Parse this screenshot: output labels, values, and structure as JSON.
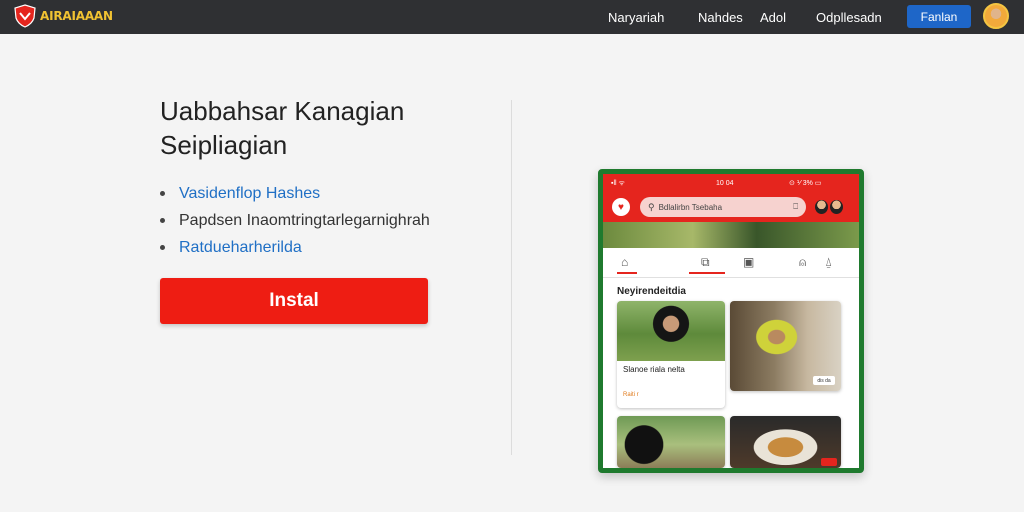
{
  "brand": {
    "name": "AIRAIAAAN",
    "accent": "#ee1d13",
    "logo_color": "#f1c232"
  },
  "nav": {
    "items": [
      "Naryariah",
      "Nahdes",
      "Adol",
      "Odpllesadn"
    ],
    "button": "Fanlan"
  },
  "hero": {
    "title_line1": "Uabbahsar Kanagian",
    "title_line2": "Seipliagian",
    "bullets": [
      "Vasidenflop Hashes",
      "Papdsen Inaomtringtarlegarnighrah",
      "Ratdueharherilda"
    ],
    "install_label": "Instal"
  },
  "phone": {
    "status_left": "▪ll ᯤ",
    "status_time": "10 04",
    "status_right": "⊙ ⅟ 3% ▭",
    "search_placeholder": "Bdlalirbn Tsebaha",
    "section_title": "Neyirendeitdia",
    "cards": [
      {
        "caption": "Slanoe riala nelta",
        "sub": "Raiti r"
      },
      {
        "chip": "dis da"
      }
    ],
    "frame_color": "#1f7a2e"
  }
}
